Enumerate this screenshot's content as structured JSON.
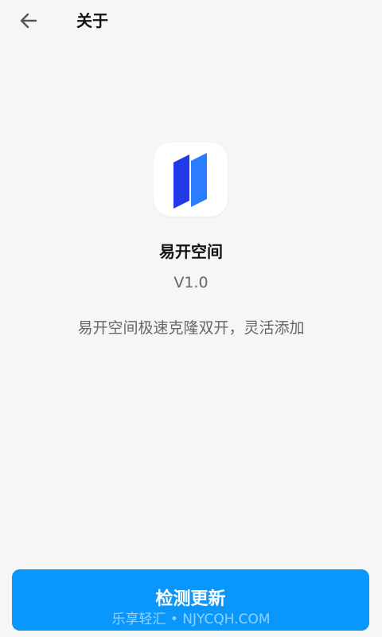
{
  "header": {
    "back_icon": "arrow-left-icon",
    "title": "关于"
  },
  "app": {
    "icon": "app-logo-icon",
    "name": "易开空间",
    "version": "V1.0",
    "description": "易开空间极速克隆双开，灵活添加"
  },
  "actions": {
    "check_update_label": "检测更新"
  },
  "watermark": {
    "text": "乐享轻汇 • NJYCQH.COM"
  },
  "colors": {
    "background": "#f6f6f6",
    "primary_button": "#0a97fb",
    "logo_dark_blue": "#1f3ae6",
    "logo_light_blue": "#2b7cff"
  }
}
